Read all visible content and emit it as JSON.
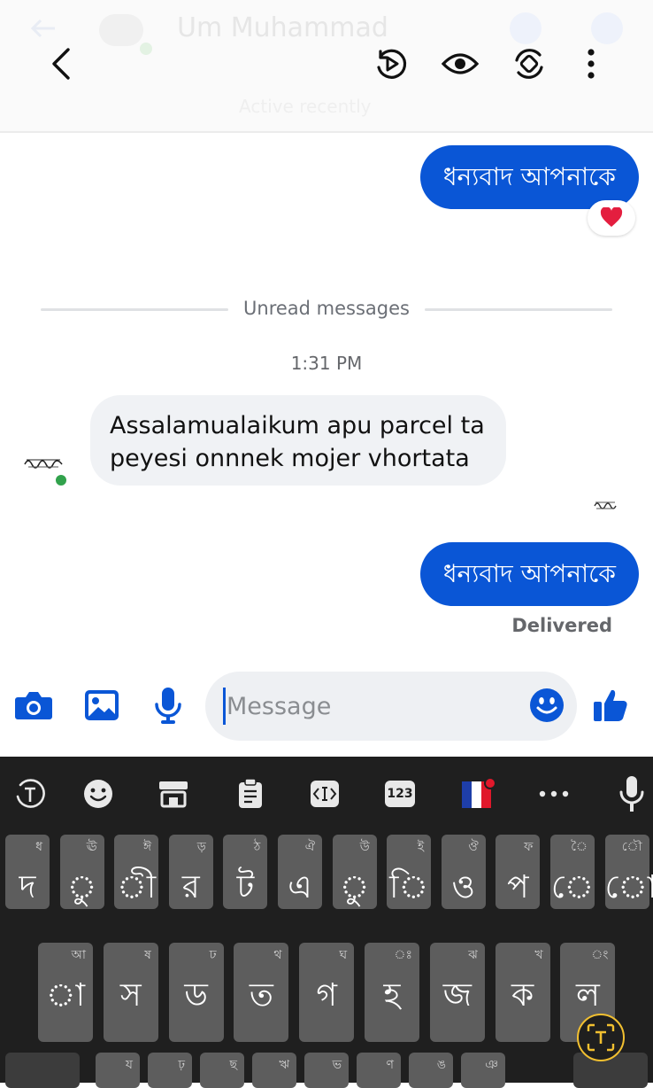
{
  "header": {
    "contact_name": "Um Muhammad",
    "subtitle": "Active recently"
  },
  "messages": {
    "outgoing_1": "ধন্যবাদ আপনাকে",
    "reaction": "❤️",
    "unread_divider": "Unread messages",
    "timestamp": "1:31 PM",
    "incoming_line1": "Assalamualaikum apu parcel ta",
    "incoming_line2": "peyesi onnnek mojer vhortata",
    "outgoing_2": "ধন্যবাদ আপনাকে",
    "status": "Delivered"
  },
  "composer": {
    "placeholder": "Message"
  },
  "keyboard": {
    "toolbar_numeric": "123",
    "row1": [
      {
        "main": "দ",
        "hint": "ধ"
      },
      {
        "main": "ু",
        "hint": "ঊ"
      },
      {
        "main": "ী",
        "hint": "ঈ"
      },
      {
        "main": "র",
        "hint": "ড়"
      },
      {
        "main": "ট",
        "hint": "ঠ"
      },
      {
        "main": "এ",
        "hint": "ঐ"
      },
      {
        "main": "ু",
        "hint": "উ"
      },
      {
        "main": "ি",
        "hint": "ই"
      },
      {
        "main": "ও",
        "hint": "ঔ"
      },
      {
        "main": "প",
        "hint": "ফ"
      },
      {
        "main": "ে",
        "hint": "ৈ"
      },
      {
        "main": "ো",
        "hint": "ৌ"
      }
    ],
    "row2": [
      {
        "main": "া",
        "hint": "আ"
      },
      {
        "main": "স",
        "hint": "ষ"
      },
      {
        "main": "ড",
        "hint": "ঢ"
      },
      {
        "main": "ত",
        "hint": "থ"
      },
      {
        "main": "গ",
        "hint": "ঘ"
      },
      {
        "main": "হ",
        "hint": "ঃ"
      },
      {
        "main": "জ",
        "hint": "ঝ"
      },
      {
        "main": "ক",
        "hint": "খ"
      },
      {
        "main": "ল",
        "hint": "ং"
      }
    ],
    "row3_hints": [
      "য",
      "ঢ়",
      "ছ",
      "ঋ",
      "ভ",
      "ণ",
      "ঙ",
      "ঞ"
    ]
  },
  "colors": {
    "accent": "#0a56d6",
    "online": "#31a24c",
    "keyboard_bg": "#1f1f1f",
    "key_bg": "#5d5d5d"
  }
}
